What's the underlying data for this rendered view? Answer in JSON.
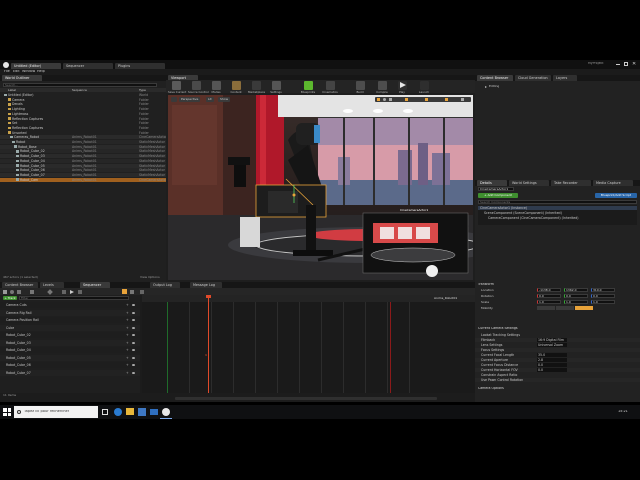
{
  "window": {
    "doc_tabs": [
      "Untitled (Editor)",
      "Sequencer",
      "Plugins"
    ],
    "menu": [
      "File",
      "Edit",
      "Window",
      "Help"
    ],
    "project_name": "MyProject"
  },
  "outliner": {
    "tab": "World Outliner",
    "search_placeholder": "Search...",
    "columns": [
      "Label",
      "Sequence",
      "Type"
    ],
    "items": [
      {
        "label": "Untitled (Editor)",
        "seq": "",
        "type": "World"
      },
      {
        "label": "Camera",
        "seq": "",
        "type": "Folder"
      },
      {
        "label": "Decals",
        "seq": "",
        "type": "Folder"
      },
      {
        "label": "Lighting",
        "seq": "",
        "type": "Folder"
      },
      {
        "label": "Lightmass",
        "seq": "",
        "type": "Folder"
      },
      {
        "label": "Reflection Captures",
        "seq": "",
        "type": "Folder"
      },
      {
        "label": "Set",
        "seq": "",
        "type": "Folder"
      },
      {
        "label": "Reflection Captures",
        "seq": "",
        "type": "Folder"
      },
      {
        "label": "Unsorted",
        "seq": "",
        "type": "Folder"
      },
      {
        "label": "Cameras_Robot",
        "seq": "Anims_Robot01",
        "type": "CineCameraActor"
      },
      {
        "label": "Robot",
        "seq": "Anims_Robot01",
        "type": "StaticMeshActor"
      },
      {
        "label": "Robot_Base",
        "seq": "Anims_Robot01",
        "type": "StaticMeshActor"
      },
      {
        "label": "Robot_Cube_02",
        "seq": "Anims_Robot01",
        "type": "StaticMeshActor"
      },
      {
        "label": "Robot_Cube_03",
        "seq": "Anims_Robot01",
        "type": "StaticMeshActor"
      },
      {
        "label": "Robot_Cube_04",
        "seq": "Anims_Robot01",
        "type": "StaticMeshActor"
      },
      {
        "label": "Robot_Cube_05",
        "seq": "Anims_Robot01",
        "type": "StaticMeshActor"
      },
      {
        "label": "Robot_Cube_06",
        "seq": "Anims_Robot01",
        "type": "StaticMeshActor"
      },
      {
        "label": "Robot_Cube_07",
        "seq": "Anims_Robot01",
        "type": "StaticMeshActor"
      },
      {
        "label": "Robot_Cam",
        "seq": "Anims_Robot01",
        "type": "CineCameraActor"
      }
    ],
    "footer_count": "467 actors (1 selected)",
    "view_options": "View Options"
  },
  "viewport": {
    "tab": "Viewport",
    "toolbar": [
      "Save Current",
      "Source Control",
      "Modes",
      "Content",
      "Marketplace",
      "Settings",
      "Blueprints",
      "Cinematics",
      "Build",
      "Compile",
      "Play",
      "Launch"
    ],
    "perspective": "Perspective",
    "lit": "Lit",
    "show": "Show",
    "pip_label": "CineCameraActor1"
  },
  "sequencer": {
    "tabs": [
      "Content Browser",
      "Levels",
      "Sequencer",
      "Output Log",
      "Message Log"
    ],
    "track_button": "+ Track",
    "filter_placeholder": "Filter",
    "sequence_name": "Anims_Robot01",
    "tracks": [
      "Camera Cuts",
      "Camera Rig Rail",
      "Camera Position Rail",
      "Cube",
      "Robot_Cube_02",
      "Robot_Cube_03",
      "Robot_Cube_04",
      "Robot_Cube_05",
      "Robot_Cube_06",
      "Robot_Cube_07"
    ],
    "frame_readout": "9",
    "footer_items": "11 items"
  },
  "modes": {
    "tabs": [
      "Content Browser",
      "Cloud Generation",
      "Layers"
    ],
    "tree_root": "Editing"
  },
  "details": {
    "tabs": [
      "Details",
      "World Settings",
      "Take Recorder",
      "Media Capture"
    ],
    "actor_name": "CineCameraActor1",
    "add_component": "+ Add Component",
    "blueprint_btn": "Blueprint/Add Script",
    "search_placeholder": "Search Components",
    "components": [
      "CineCameraActor1 (Instance)",
      "SceneComponent (SceneComponent) (Inherited)",
      "CameraComponent (CineCameraComponent) (Inherited)"
    ],
    "transform_header": "Transform",
    "location": [
      "-1138.0",
      "1362.0",
      "310.0"
    ],
    "rotation": [
      "0.0",
      "0.0",
      "0.0"
    ],
    "scale": [
      "1.0",
      "1.0",
      "1.0"
    ],
    "sections": [
      "Current Camera Settings",
      "Camera Options"
    ],
    "props": [
      {
        "label": "Lookat Tracking Settings",
        "value": ""
      },
      {
        "label": "Filmback",
        "value": "16:9 Digital Film"
      },
      {
        "label": "Lens Settings",
        "value": "Universal Zoom"
      },
      {
        "label": "Focus Settings",
        "value": ""
      },
      {
        "label": "Current Focal Length",
        "value": "35.0"
      },
      {
        "label": "Current Aperture",
        "value": "2.8"
      },
      {
        "label": "Current Focus Distance",
        "value": "0.0"
      },
      {
        "label": "Current Horizontal FOV",
        "value": "0.0"
      },
      {
        "label": "Constrain Aspect Ratio",
        "value": ""
      },
      {
        "label": "Use Pawn Control Rotation",
        "value": ""
      }
    ],
    "labels": {
      "location": "Location",
      "rotation": "Rotation",
      "scale": "Scale",
      "mobility": "Mobility"
    }
  },
  "taskbar": {
    "search_placeholder": "Tapez ici pour rechercher",
    "clock": "15:21"
  },
  "colors": {
    "accent": "#e8a33a",
    "green_button": "#3f8f2f",
    "blue_button": "#2865a8",
    "selected_row": "#a0601e"
  }
}
